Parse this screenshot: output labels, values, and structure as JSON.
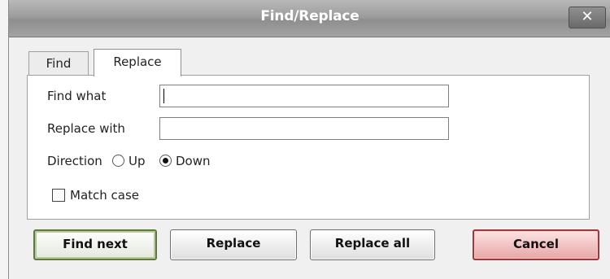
{
  "window": {
    "title": "Find/Replace",
    "close_glyph": "✕"
  },
  "tabs": [
    {
      "label": "Find",
      "active": false
    },
    {
      "label": "Replace",
      "active": true
    }
  ],
  "fields": {
    "find_label": "Find what",
    "find_value": "",
    "replace_label": "Replace with",
    "replace_value": ""
  },
  "direction": {
    "label": "Direction",
    "options": [
      {
        "label": "Up",
        "selected": false
      },
      {
        "label": "Down",
        "selected": true
      }
    ]
  },
  "match_case": {
    "label": "Match case",
    "checked": false
  },
  "buttons": {
    "find_next": "Find next",
    "replace": "Replace",
    "replace_all": "Replace all",
    "cancel": "Cancel"
  },
  "colors": {
    "titlebar": "#9d9d9d",
    "find_next_border": "#5e7a3c",
    "cancel_fill": "#e9a6a6"
  },
  "icons": {
    "close": "close-icon"
  }
}
